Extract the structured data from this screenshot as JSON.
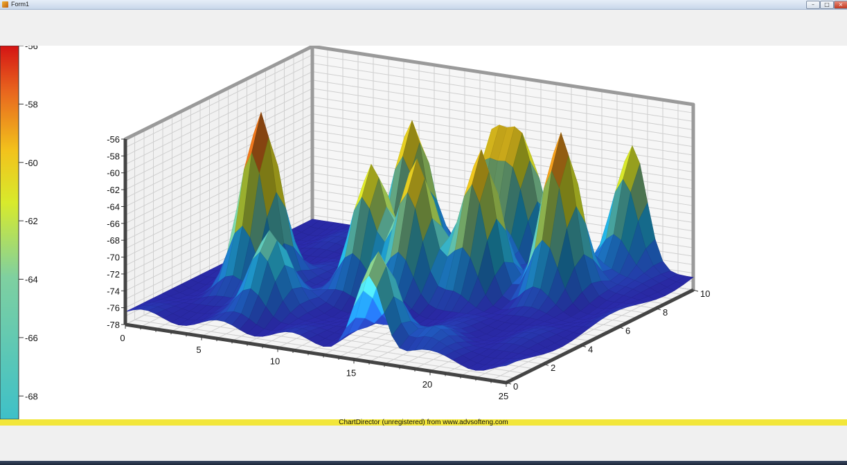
{
  "window": {
    "title": "Form1"
  },
  "footer": {
    "text": "ChartDirector (unregistered) from www.advsofteng.com"
  },
  "chart_data": {
    "type": "surface",
    "x_ticks": [
      "0",
      "5",
      "10",
      "15",
      "20",
      "25"
    ],
    "y_ticks": [
      "0",
      "2",
      "4",
      "6",
      "8",
      "10"
    ],
    "z_ticks": [
      "-78",
      "-76",
      "-74",
      "-72",
      "-70",
      "-68",
      "-66",
      "-64",
      "-62",
      "-60",
      "-58",
      "-56"
    ],
    "colorbar_ticks": [
      "-56",
      "-58",
      "-60",
      "-62",
      "-64",
      "-66",
      "-68"
    ],
    "xlim": [
      0,
      25
    ],
    "ylim": [
      0,
      10
    ],
    "zlim": [
      -78,
      -56
    ],
    "colorbar_range": [
      -68.8,
      -56
    ],
    "colorscale": [
      "#2a2aa8",
      "#1e6fd0",
      "#23b8e6",
      "#7fd0a0",
      "#d8ea2c",
      "#f2c21c",
      "#e8641e",
      "#d41414"
    ],
    "grid": true,
    "surface_peaks": [
      {
        "x": 4,
        "y": 4,
        "z": -56.3
      },
      {
        "x": 9,
        "y": 8,
        "z": -60.5
      },
      {
        "x": 10,
        "y": 5,
        "z": -62
      },
      {
        "x": 7,
        "y": 2,
        "z": -67
      },
      {
        "x": 13,
        "y": 5,
        "z": -60
      },
      {
        "x": 13,
        "y": 9,
        "z": -63
      },
      {
        "x": 15,
        "y": 9,
        "z": -62
      },
      {
        "x": 16,
        "y": 6,
        "z": -60
      },
      {
        "x": 16,
        "y": 0.5,
        "z": -66
      },
      {
        "x": 20,
        "y": 7,
        "z": -57.5
      },
      {
        "x": 21,
        "y": 10,
        "z": -62
      },
      {
        "x": 19,
        "y": 1,
        "z": -74
      }
    ],
    "baseline_z": -76.5
  }
}
